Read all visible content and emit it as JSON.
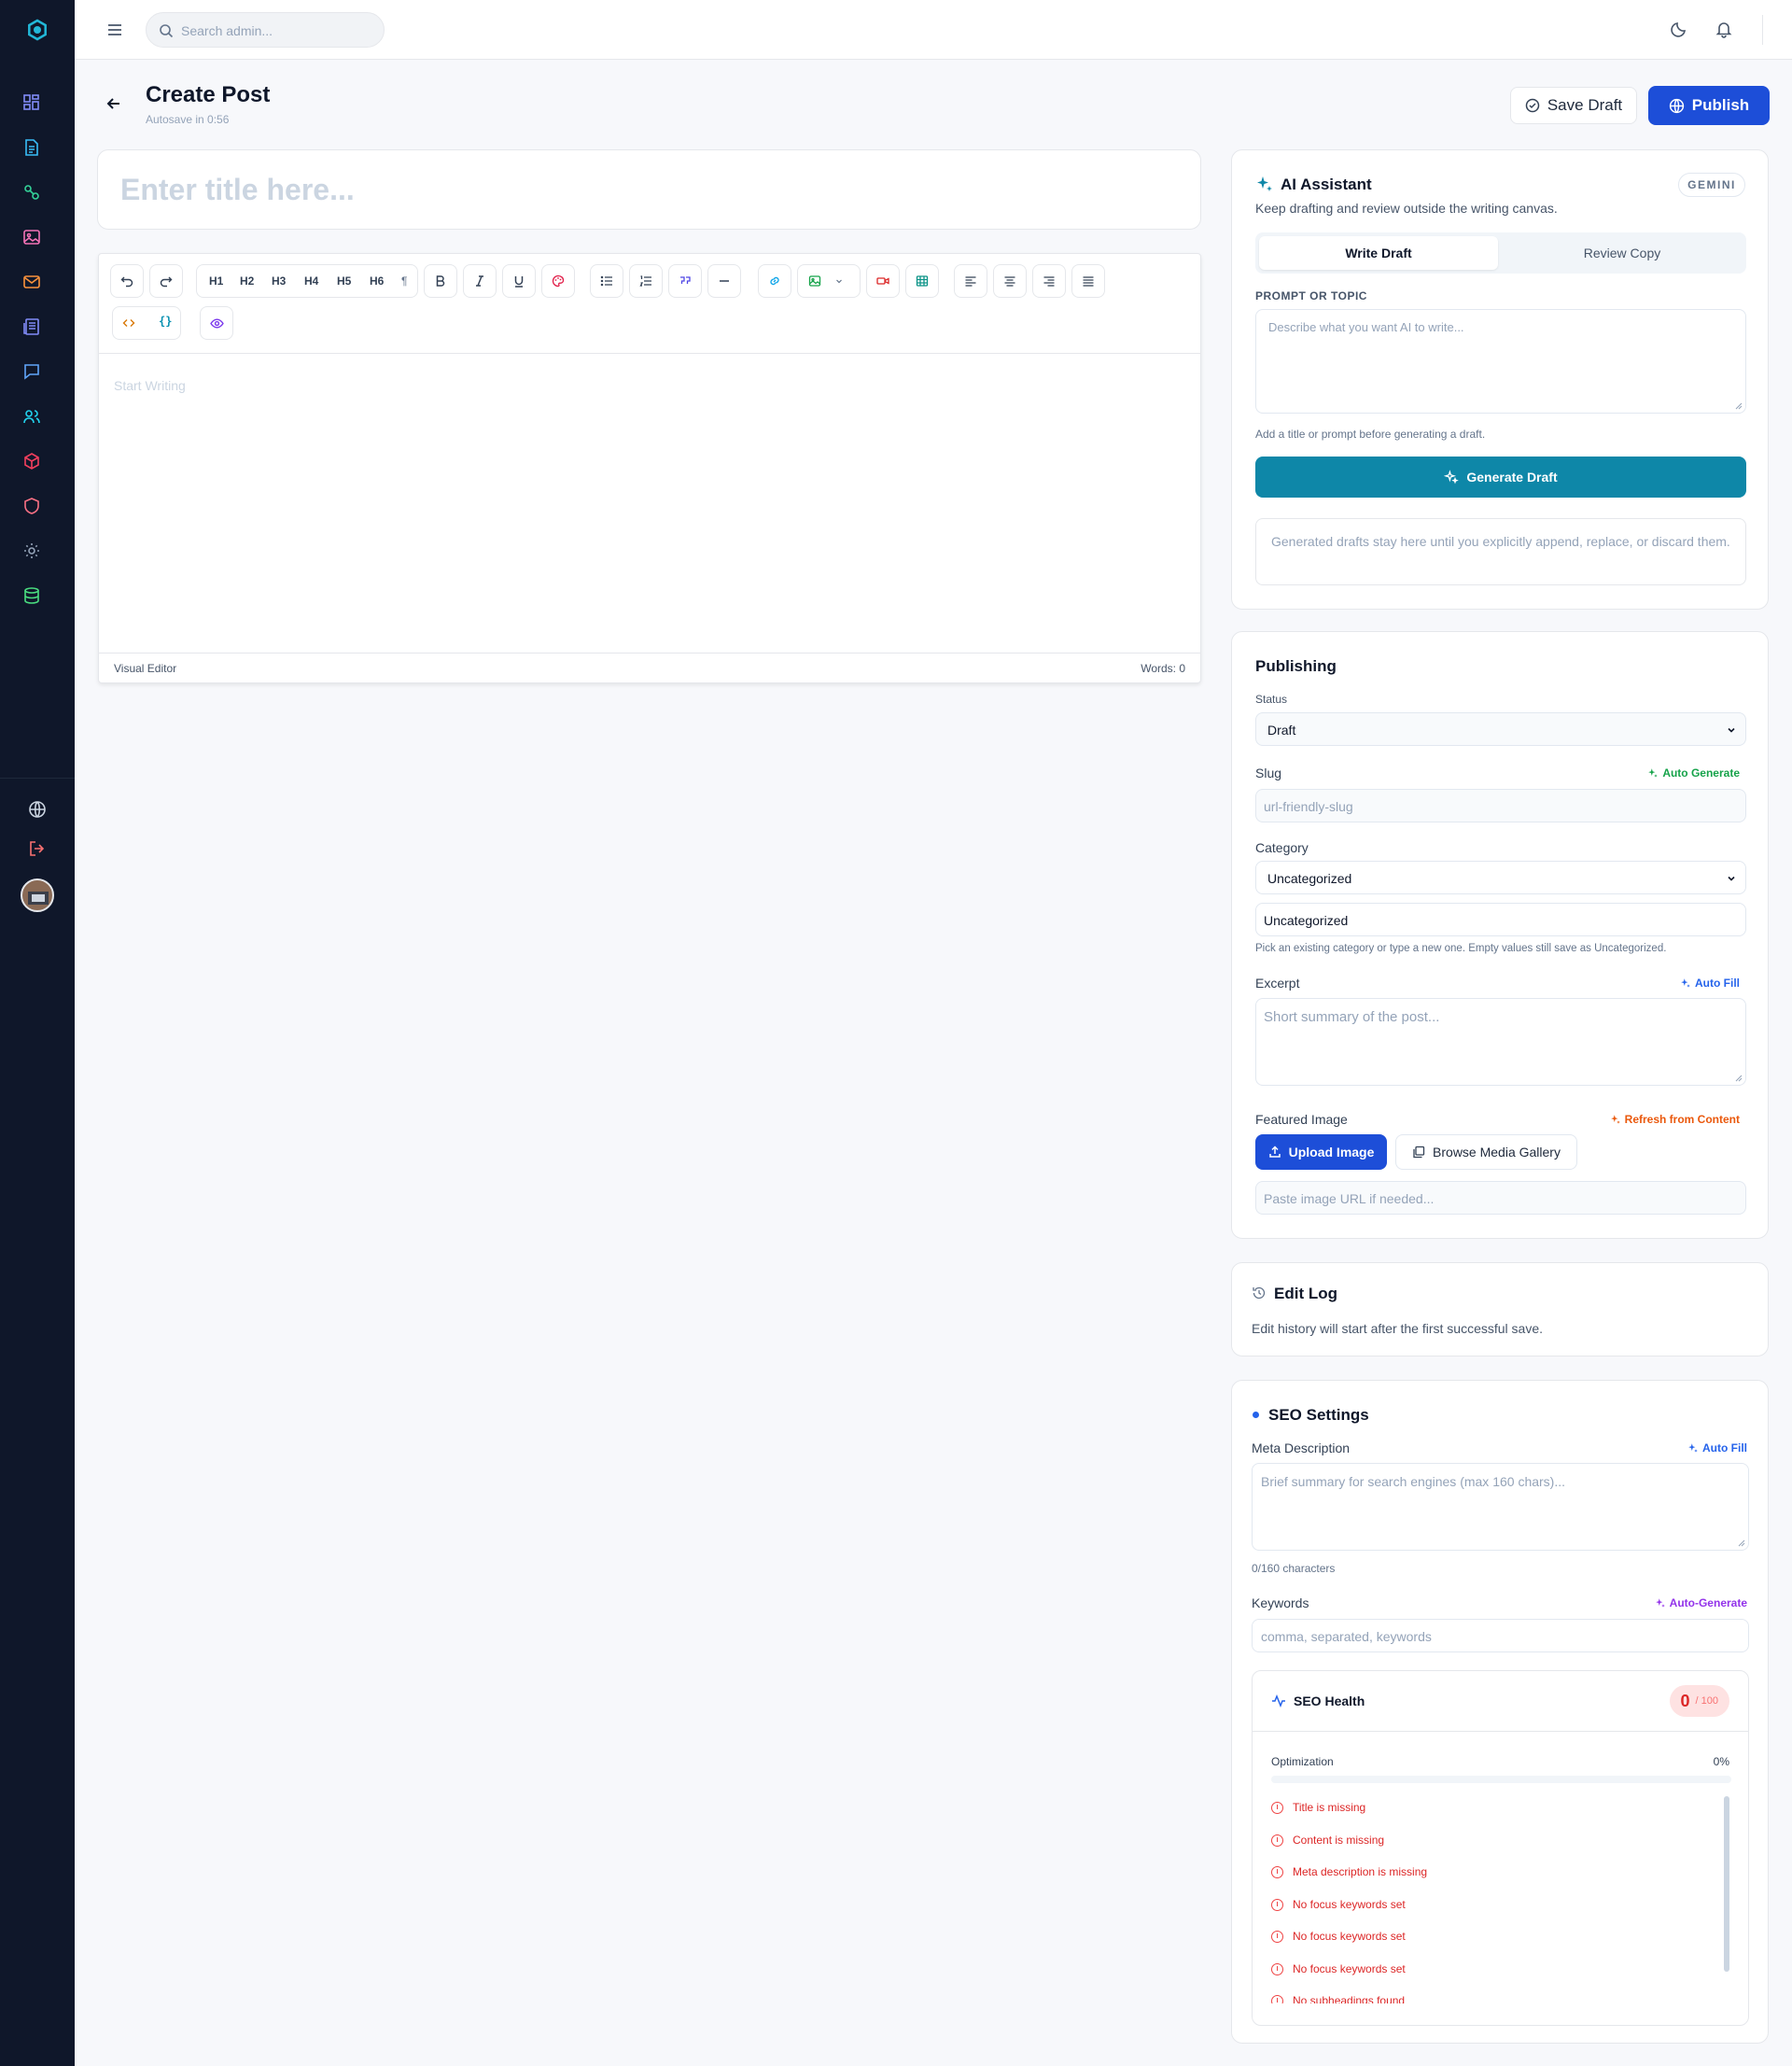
{
  "header": {
    "search_placeholder": "Search admin..."
  },
  "page": {
    "title": "Create Post",
    "autosave": "Autosave in 0:56",
    "save_draft": "Save Draft",
    "publish": "Publish"
  },
  "editor": {
    "title_placeholder": "Enter title here...",
    "headings": [
      "H1",
      "H2",
      "H3",
      "H4",
      "H5",
      "H6"
    ],
    "paragraph_mark": "¶",
    "body_placeholder": "Start Writing",
    "mode": "Visual Editor",
    "word_count": "Words: 0"
  },
  "ai": {
    "title": "AI Assistant",
    "badge": "GEMINI",
    "subtitle": "Keep drafting and review outside the writing canvas.",
    "tab_write": "Write Draft",
    "tab_review": "Review Copy",
    "prompt_label": "PROMPT OR TOPIC",
    "prompt_placeholder": "Describe what you want AI to write...",
    "hint": "Add a title or prompt before generating a draft.",
    "generate": "Generate Draft",
    "note": "Generated drafts stay here until you explicitly append, replace, or discard them."
  },
  "publishing": {
    "title": "Publishing",
    "status_label": "Status",
    "status_value": "Draft",
    "slug_label": "Slug",
    "slug_action": "Auto Generate",
    "slug_placeholder": "url-friendly-slug",
    "category_label": "Category",
    "category_value": "Uncategorized",
    "category_input": "Uncategorized",
    "category_hint": "Pick an existing category or type a new one. Empty values still save as Uncategorized.",
    "excerpt_label": "Excerpt",
    "excerpt_action": "Auto Fill",
    "excerpt_placeholder": "Short summary of the post...",
    "featured_label": "Featured Image",
    "featured_action": "Refresh from Content",
    "upload": "Upload Image",
    "browse": "Browse Media Gallery",
    "url_placeholder": "Paste image URL if needed..."
  },
  "editlog": {
    "title": "Edit Log",
    "text": "Edit history will start after the first successful save."
  },
  "seo": {
    "title": "SEO Settings",
    "meta_label": "Meta Description",
    "meta_action": "Auto Fill",
    "meta_placeholder": "Brief summary for search engines (max 160 chars)...",
    "meta_count": "0/160 characters",
    "keywords_label": "Keywords",
    "keywords_action": "Auto-Generate",
    "keywords_placeholder": "comma, separated, keywords",
    "health_title": "SEO Health",
    "score": "0",
    "score_max": "/ 100",
    "optimization_label": "Optimization",
    "optimization_value": "0%",
    "optimization_fraction": 0,
    "issues": [
      "Title is missing",
      "Content is missing",
      "Meta description is missing",
      "No focus keywords set",
      "No focus keywords set",
      "No focus keywords set",
      "No subheadings found"
    ]
  },
  "colors": {
    "sidebar": "#0f172a",
    "primary": "#1d4ed8",
    "teal": "#0e87a8",
    "danger": "#dc2626",
    "green": "#16a34a",
    "purple": "#9333ea",
    "orange": "#ea580c"
  }
}
